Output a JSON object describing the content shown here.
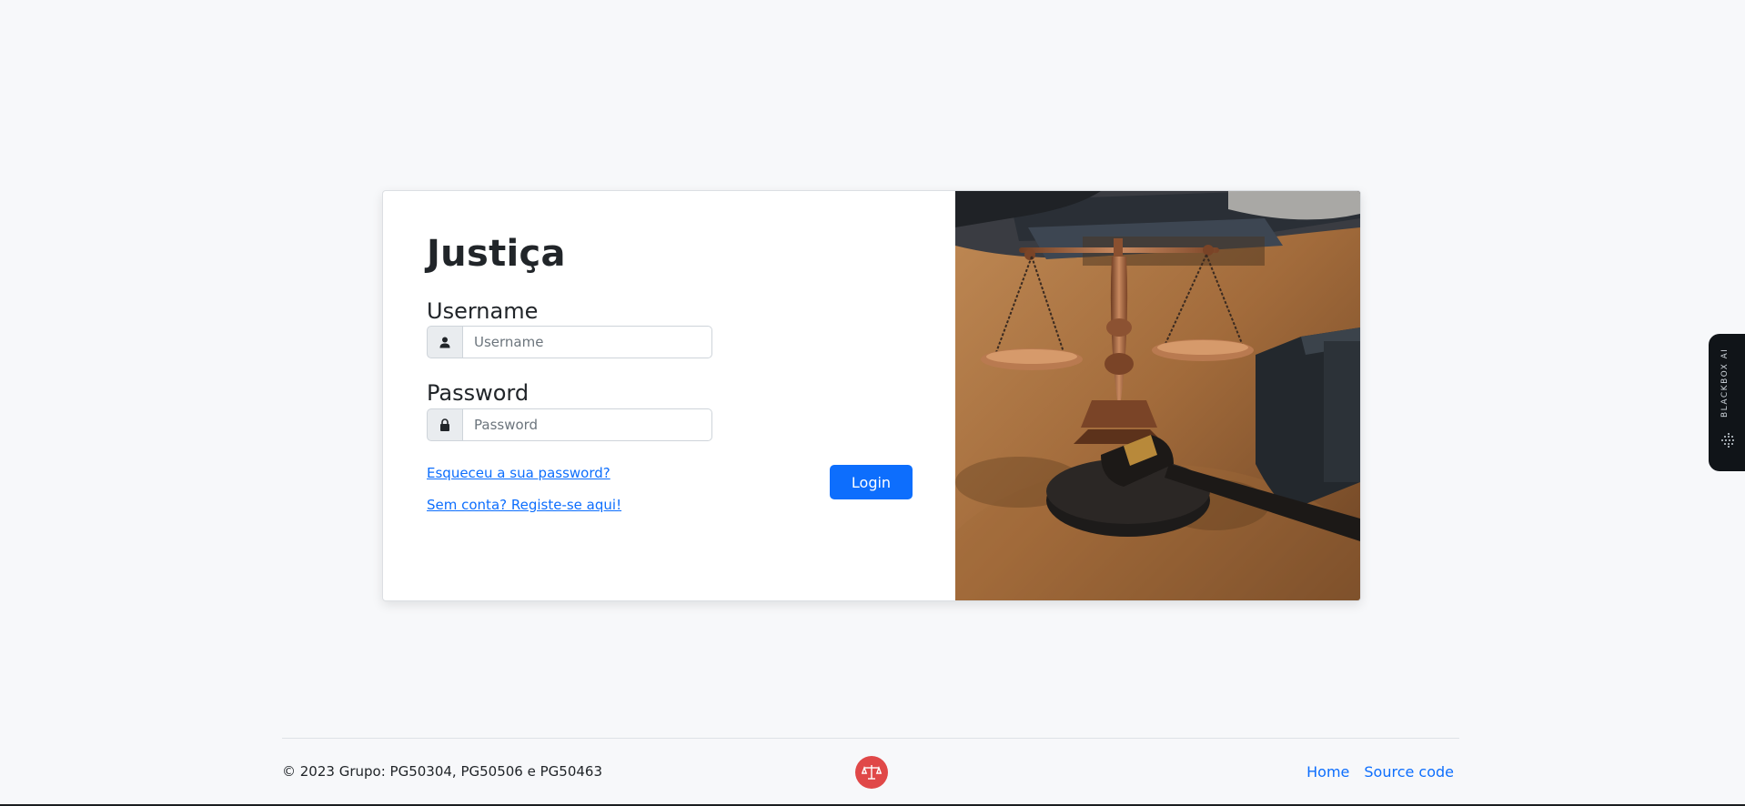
{
  "login": {
    "brand": "Justiça",
    "username_label": "Username",
    "username_placeholder": "Username",
    "username_value": "",
    "password_label": "Password",
    "password_placeholder": "Password",
    "password_value": "",
    "forgot_link": "Esqueceu a sua password?",
    "register_link": "Sem conta? Registe-se aqui!",
    "login_button": "Login",
    "user_icon": "person-icon",
    "lock_icon": "lock-icon",
    "accent_color": "#0d6efd"
  },
  "side_widget": {
    "label": "BLACKBOX AI"
  },
  "footer": {
    "copyright": "© 2023 Grupo: PG50304, PG50506 e PG50463",
    "logo_icon": "scales-of-justice-icon",
    "logo_color": "#e04848",
    "nav": [
      {
        "label": "Home"
      },
      {
        "label": "Source code"
      }
    ]
  }
}
